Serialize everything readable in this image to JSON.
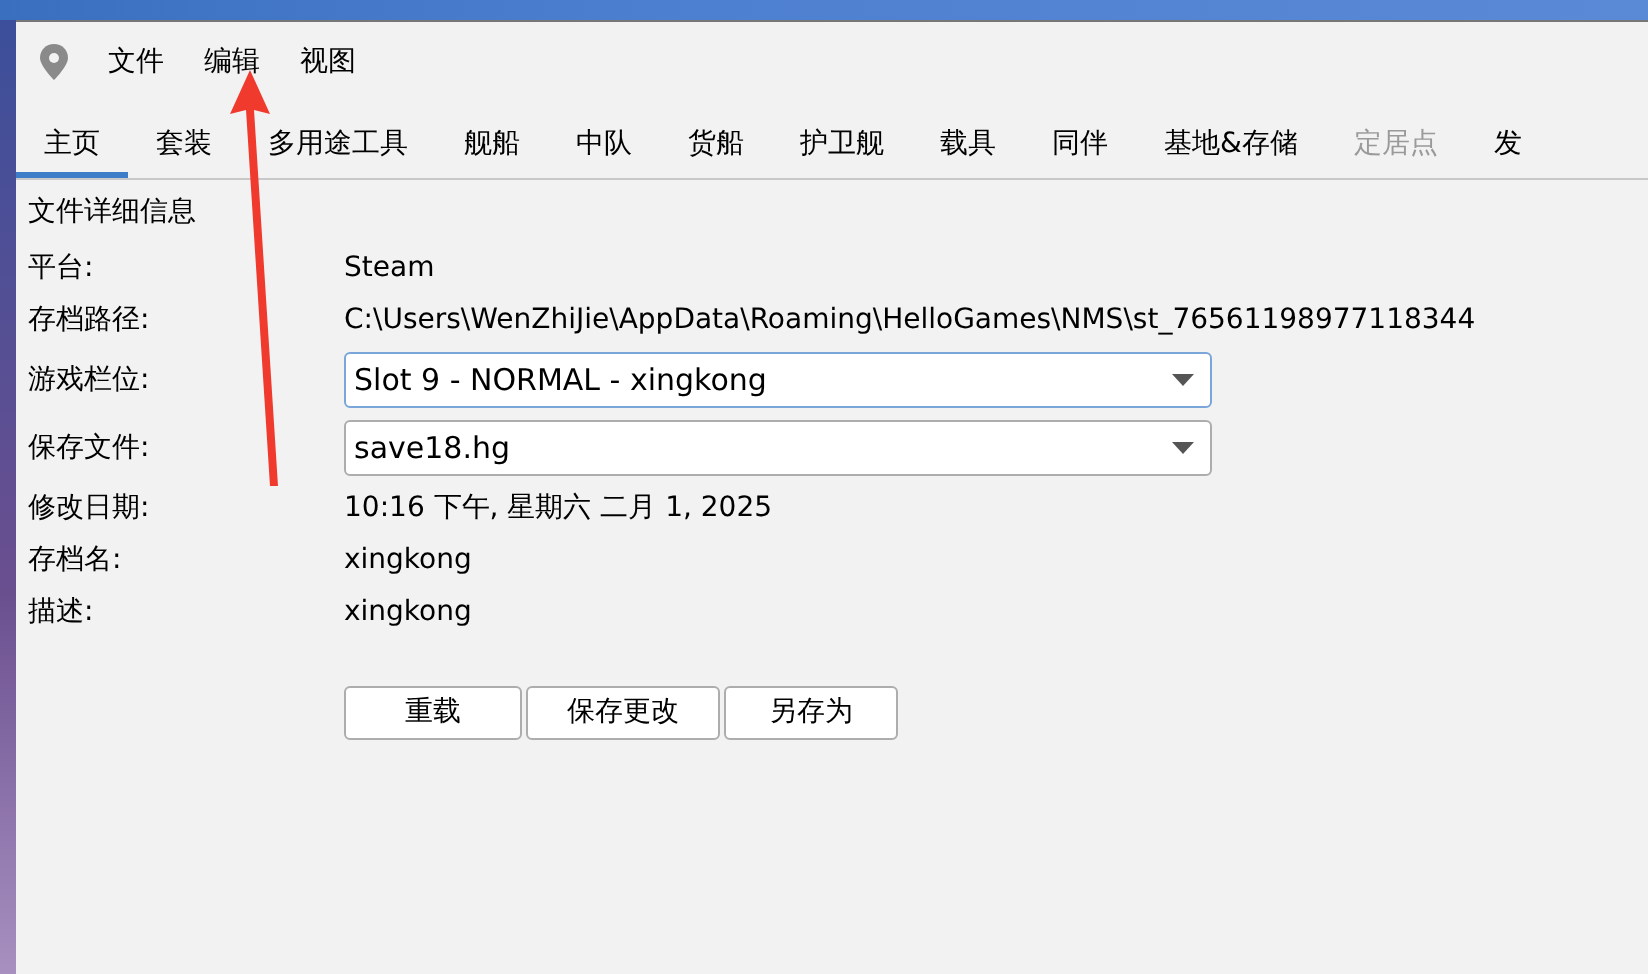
{
  "menu": [
    "文件",
    "编辑",
    "视图"
  ],
  "tabs": [
    {
      "label": "主页",
      "selected": true,
      "disabled": false
    },
    {
      "label": "套装",
      "selected": false,
      "disabled": false
    },
    {
      "label": "多用途工具",
      "selected": false,
      "disabled": false
    },
    {
      "label": "舰船",
      "selected": false,
      "disabled": false
    },
    {
      "label": "中队",
      "selected": false,
      "disabled": false
    },
    {
      "label": "货船",
      "selected": false,
      "disabled": false
    },
    {
      "label": "护卫舰",
      "selected": false,
      "disabled": false
    },
    {
      "label": "载具",
      "selected": false,
      "disabled": false
    },
    {
      "label": "同伴",
      "selected": false,
      "disabled": false
    },
    {
      "label": "基地&存储",
      "selected": false,
      "disabled": false
    },
    {
      "label": "定居点",
      "selected": false,
      "disabled": true
    },
    {
      "label": "发",
      "selected": false,
      "disabled": false
    }
  ],
  "section_title": "文件详细信息",
  "fields": [
    {
      "kind": "text",
      "label": "平台:",
      "value": "Steam"
    },
    {
      "kind": "text",
      "label": "存档路径:",
      "value": "C:\\Users\\WenZhiJie\\AppData\\Roaming\\HelloGames\\NMS\\st_76561198977118344"
    },
    {
      "kind": "dropdown",
      "label": "游戏栏位:",
      "value": "Slot 9 - NORMAL - xingkong",
      "focused": true
    },
    {
      "kind": "dropdown",
      "label": "保存文件:",
      "value": "save18.hg",
      "focused": false
    },
    {
      "kind": "text",
      "label": "修改日期:",
      "value": "10:16 下午, 星期六 二月 1, 2025"
    },
    {
      "kind": "text",
      "label": "存档名:",
      "value": "xingkong"
    },
    {
      "kind": "text",
      "label": "描述:",
      "value": "xingkong"
    }
  ],
  "buttons": [
    "重载",
    "保存更改",
    "另存为"
  ]
}
